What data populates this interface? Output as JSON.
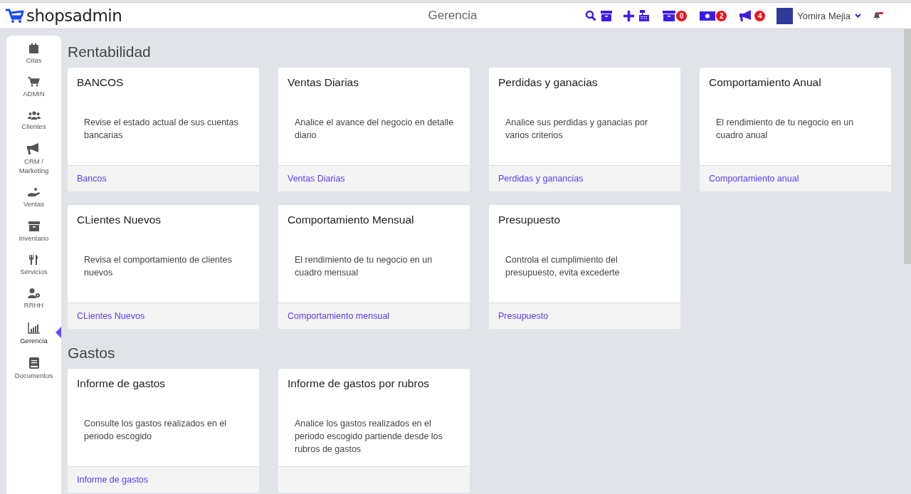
{
  "header": {
    "logo": "shopsadmin",
    "title": "Gerencia",
    "badges": [
      {
        "kind": "box",
        "count": "0"
      },
      {
        "kind": "money",
        "count": "2"
      },
      {
        "kind": "megaphone",
        "count": "4"
      }
    ],
    "user": "Yomira Mejia"
  },
  "sidebar": {
    "items": [
      {
        "kind": "calendar",
        "label": "Citas",
        "selected": false
      },
      {
        "kind": "cart",
        "label": "ADMIN",
        "selected": false
      },
      {
        "kind": "users",
        "label": "Clientes",
        "selected": false
      },
      {
        "kind": "megaphone",
        "label": "CRM / Marketing",
        "selected": false
      },
      {
        "kind": "hand",
        "label": "Ventas",
        "selected": false
      },
      {
        "kind": "archive",
        "label": "Inventario",
        "selected": false
      },
      {
        "kind": "utensils",
        "label": "Servicios",
        "selected": false
      },
      {
        "kind": "usergear",
        "label": "RRHH",
        "selected": false
      },
      {
        "kind": "chart",
        "label": "Gerencia",
        "selected": true
      },
      {
        "kind": "book",
        "label": "Documentos",
        "selected": false
      }
    ]
  },
  "sections": [
    {
      "title": "Rentabilidad",
      "cards": [
        {
          "title": "BANCOS",
          "description": "Revise el estado actual de sus cuentas bancarias",
          "link": "Bancos"
        },
        {
          "title": "Ventas Diarias",
          "description": "Analice el avance del negocio en detalle diario",
          "link": "Ventas Diarias"
        },
        {
          "title": "Perdidas y ganacias",
          "description": "Analice sus perdidas y ganacias por varios criterios",
          "link": "Perdidas y ganancias"
        },
        {
          "title": "Comportamiento Anual",
          "description": "El rendimiento de tu negocio en un cuadro anual",
          "link": "Comportamiento anual"
        },
        {
          "title": "CLientes Nuevos",
          "description": "Revisa el comportamiento de clientes nuevos",
          "link": "CLientes Nuevos"
        },
        {
          "title": "Comportamiento Mensual",
          "description": "El rendimiento de tu negocio en un cuadro mensual",
          "link": "Comportamiento mensual"
        },
        {
          "title": "Presupuesto",
          "description": "Controla el cumplimiento del presupuesto, evita excederte",
          "link": "Presupuesto"
        }
      ]
    },
    {
      "title": "Gastos",
      "cards": [
        {
          "title": "Informe de gastos",
          "description": "Consulte los gastos realizados en el periodo escogido",
          "link": "Informe de gastos"
        },
        {
          "title": "Informe de gastos por rubros",
          "description": "Analice los gastos realizados en el periodo escogido partiende desde los rubros de gastos"
        }
      ]
    }
  ]
}
